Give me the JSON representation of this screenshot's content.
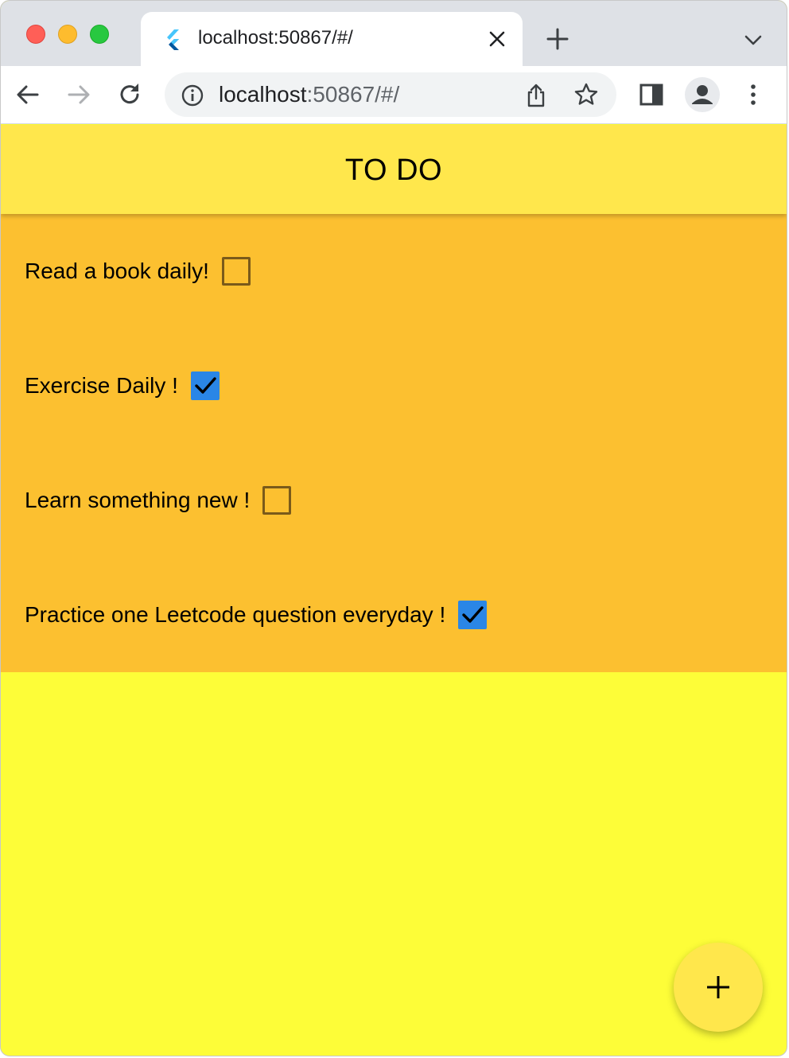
{
  "browser": {
    "tab": {
      "title": "localhost:50867/#/",
      "favicon": "flutter-icon"
    },
    "address_bar": {
      "host": "localhost",
      "path": ":50867/#/"
    },
    "icons": [
      "back-arrow-icon",
      "forward-arrow-icon",
      "reload-icon",
      "info-icon",
      "share-icon",
      "bookmark-star-icon",
      "side-panel-icon",
      "profile-icon",
      "menu-dots-icon",
      "new-tab-plus-icon",
      "tab-search-chevron-icon",
      "tab-close-icon"
    ]
  },
  "app": {
    "title": "TO DO",
    "colors": {
      "appbar": "#ffe74c",
      "panel": "#fcc030",
      "background": "#fdfd38",
      "checkbox_checked": "#2a86e6"
    },
    "todos": [
      {
        "label": "Read a book daily!",
        "checked": false
      },
      {
        "label": "Exercise Daily !",
        "checked": true
      },
      {
        "label": "Learn something new !",
        "checked": false
      },
      {
        "label": "Practice one Leetcode question everyday !",
        "checked": true
      }
    ],
    "fab_icon": "add-plus-icon"
  }
}
